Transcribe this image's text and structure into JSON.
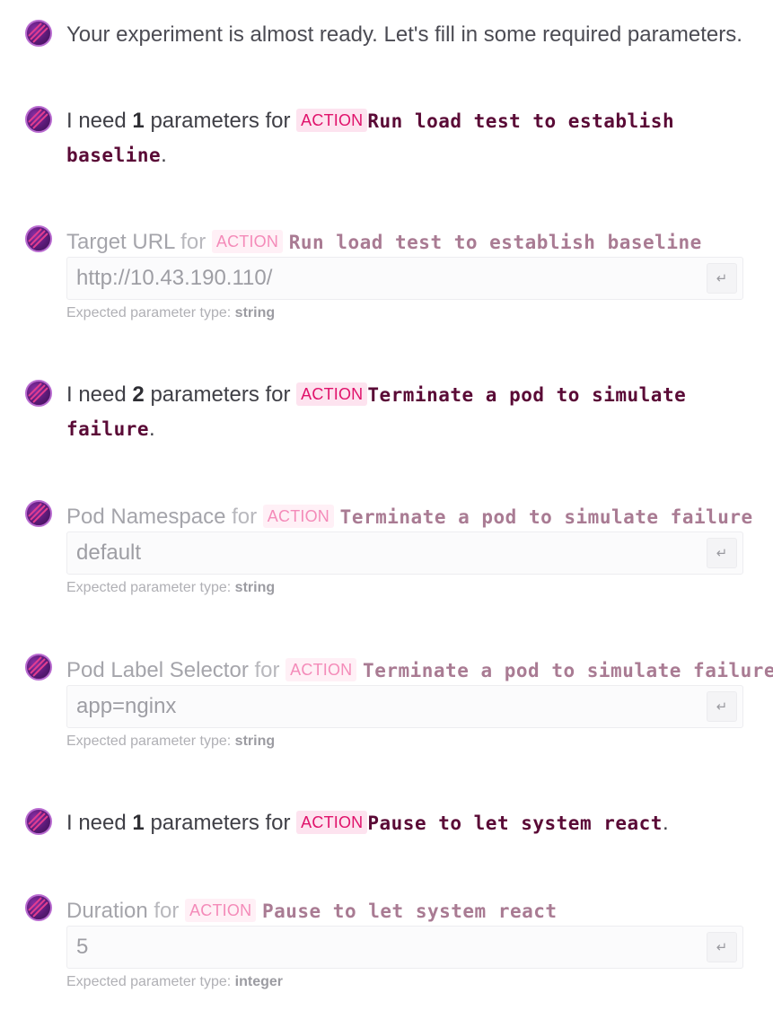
{
  "intro": "Your experiment is almost ready. Let's fill in some required parameters.",
  "need_prefix": "I need",
  "need_suffix": "parameters for",
  "for_word": "for",
  "badge": "ACTION",
  "hint_prefix": "Expected parameter type:",
  "enter_symbol": "↵",
  "groups": [
    {
      "count": "1",
      "action": "Run load test to establish baseline",
      "params": [
        {
          "label": "Target URL",
          "action": "Run load test to establish baseline",
          "value": "http://10.43.190.110/",
          "type": "string"
        }
      ]
    },
    {
      "count": "2",
      "action": "Terminate a pod to simulate failure",
      "params": [
        {
          "label": "Pod Namespace",
          "action": "Terminate a pod to simulate failure",
          "value": "default",
          "type": "string"
        },
        {
          "label": "Pod Label Selector",
          "action": "Terminate a pod to simulate failure",
          "value": "app=nginx",
          "type": "string"
        }
      ]
    },
    {
      "count": "1",
      "action": "Pause to let system react",
      "params": [
        {
          "label": "Duration",
          "action": "Pause to let system react",
          "value": "5",
          "type": "integer"
        }
      ]
    }
  ]
}
